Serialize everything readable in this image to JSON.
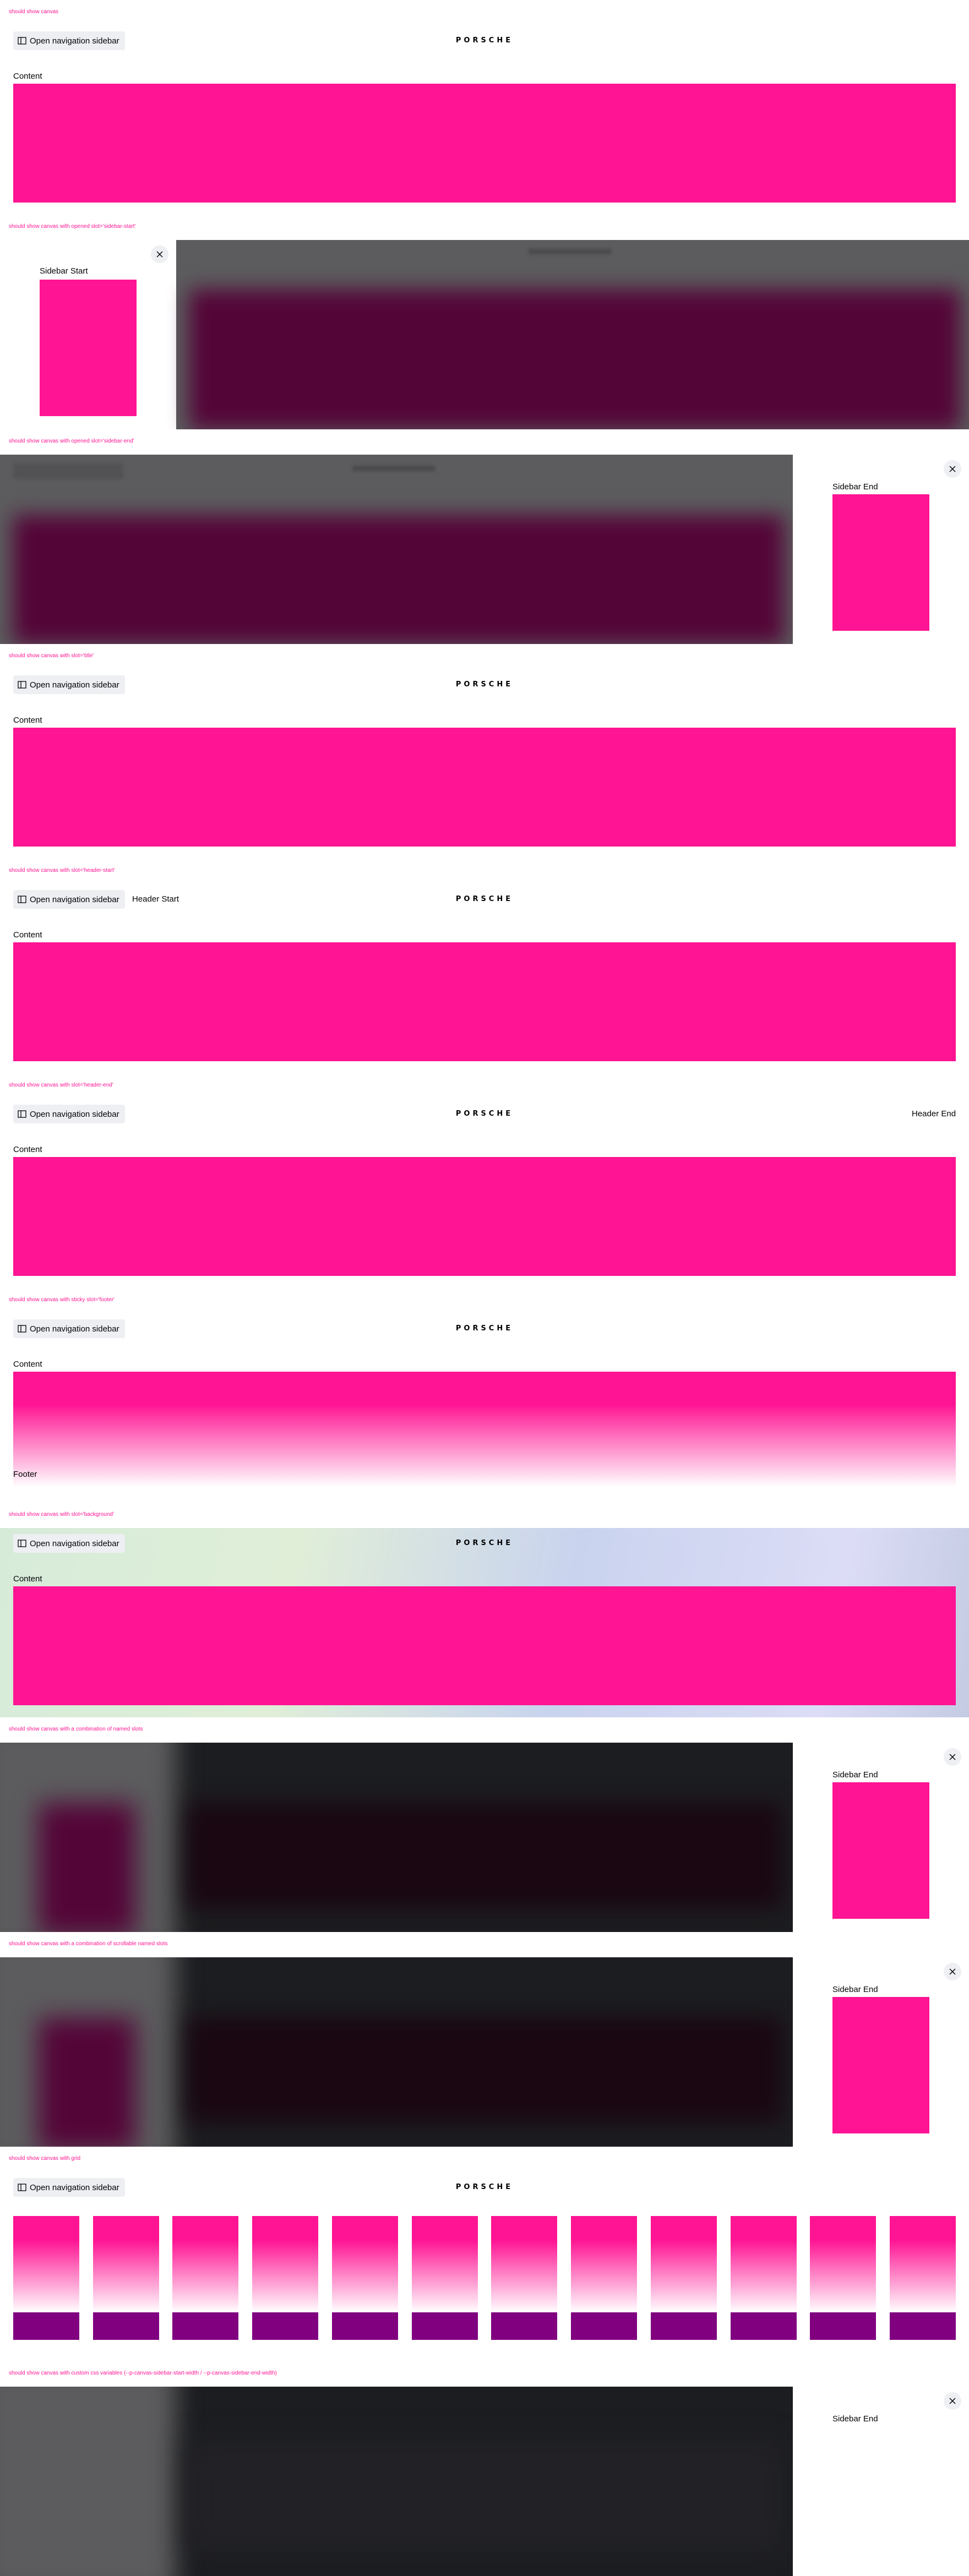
{
  "headings": [
    "should show canvas",
    "should show canvas with opened slot='sidebar-start'",
    "should show canvas with opened slot='sidebar-end'",
    "should show canvas with slot='title'",
    "should show canvas with slot='header-start'",
    "should show canvas with slot='header-end'",
    "should show canvas with sticky slot='footer'",
    "should show canvas with slot='background'",
    "should show canvas with a combination of named slots",
    "should show canvas with a combination of scrollable named slots",
    "should show canvas with grid",
    "should show canvas with custom css variables (--p-canvas-sidebar-start-width / --p-canvas-sidebar-end-width)"
  ],
  "nav_button_label": "Open navigation sidebar",
  "crest_text": "PORSCHE",
  "content_label": "Content",
  "sidebar_start_label": "Sidebar Start",
  "sidebar_end_label": "Sidebar End",
  "header_start_label": "Header Start",
  "header_end_label": "Header End",
  "footer_label": "Footer",
  "icons": {
    "nav": "sidebar-icon",
    "close": "close-icon"
  },
  "colors": {
    "accent": "#ff1493",
    "grid_bottom": "#800080",
    "backdrop": "#5c5c5e",
    "dark_backdrop": "#1c1d20"
  },
  "grid_columns": 12
}
